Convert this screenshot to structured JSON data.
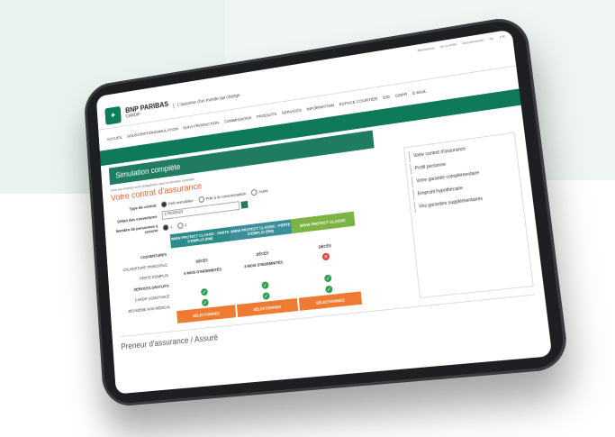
{
  "topbar": {
    "links": [
      "Bienvenue",
      "00-0-0000",
      "Déconnexion",
      "NL",
      "FR"
    ]
  },
  "brand": {
    "name": "BNP PARIBAS",
    "sub": "CARDIF",
    "tagline": "L'assureur d'un monde qui change"
  },
  "nav": {
    "items": [
      "ACCUEIL",
      "SOUSCRIPTION/SIMULATION",
      "SUIVI PRODUCTION",
      "COMMISSIONS",
      "PRODUITS",
      "SERVICES",
      "INFORMATION",
      "ESPACE COURTIER",
      "EID",
      "GDPR",
      "E-MAIL"
    ]
  },
  "page": {
    "title": "Simulation complète",
    "required_note": "Tous les champs sont obligatoires sauf si mention contraire",
    "section_title": "Votre contrat d'assurance"
  },
  "form": {
    "contract_label": "Type de contrat",
    "contract_options": [
      "Prêt immobilier",
      "Prêt à la consommation",
      "Autre"
    ],
    "start_label": "Début des couvertures",
    "start_value": "17/03/2023",
    "persons_label": "Nombre de personnes à assurer",
    "persons_options": [
      "1",
      "2"
    ]
  },
  "plans": {
    "headers": [
      "WWW PROTECT CLASSIC - PERTE D'EMPLOI (RM)",
      "WWW PROTECT CLASSIC - PERTE D'EMPLOI (RM)",
      "WWW PROTECT CLASSIC"
    ],
    "rows": {
      "coverages": "COUVERTURES",
      "main": "COUVERTURE PRINCIPALE",
      "main_values": [
        "DÉCÈS",
        "DÉCÈS",
        "DÉCÈS"
      ],
      "job": "PERTE D'EMPLOI",
      "job_values": [
        "6 MOIS D'INDEMNITÉS",
        "3 MOIS D'INDEMNITÉS"
      ],
      "free": "SERVICES GRATUITS",
      "assist": "CARDIF ASSISTANCE",
      "medical": "DEUXIÈME AVIS MÉDICAL"
    },
    "select_label": "SÉLECTIONNEZ"
  },
  "sidebar": {
    "items": [
      "Votre contrat d'assurance",
      "Profil personne",
      "Votre garantie complémentaire",
      "Emprunt hypothécaire",
      "Vos garanties supplémentaires"
    ]
  },
  "bottom": {
    "title": "Preneur d'assurance / Assuré"
  }
}
